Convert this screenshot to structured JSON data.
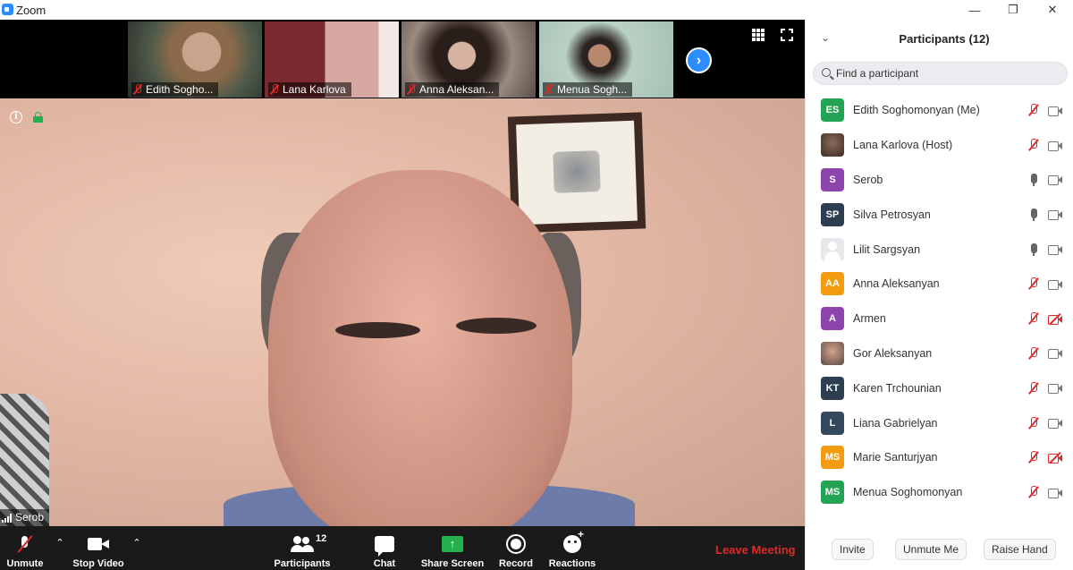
{
  "window": {
    "title": "Zoom",
    "controls": [
      "—",
      "❐",
      "✕"
    ]
  },
  "thumbnails": [
    {
      "name": "Edith Sogho...",
      "muted": true
    },
    {
      "name": "Lana Karlova",
      "muted": true
    },
    {
      "name": "Anna Aleksan...",
      "muted": true
    },
    {
      "name": "Menua Sogh...",
      "muted": true
    }
  ],
  "icons": {
    "next": "›",
    "info": "i",
    "caret": "⌃",
    "share_arrow": "↑",
    "collapse": "⌄"
  },
  "main_video": {
    "speaker": "Serob"
  },
  "toolbar": {
    "unmute": "Unmute",
    "stop_video": "Stop Video",
    "participants": "Participants",
    "participants_count": "12",
    "chat": "Chat",
    "share_screen": "Share Screen",
    "record": "Record",
    "reactions": "Reactions",
    "leave": "Leave Meeting"
  },
  "panel": {
    "title": "Participants (12)",
    "search_placeholder": "Find a participant",
    "participants": [
      {
        "initials": "ES",
        "name": "Edith Soghomonyan (Me)",
        "color": "#23a455",
        "mic": "off",
        "cam": "on"
      },
      {
        "initials": "",
        "name": "Lana Karlova (Host)",
        "color": "photo-lana",
        "mic": "off",
        "cam": "on"
      },
      {
        "initials": "S",
        "name": "Serob",
        "color": "#8e44ad",
        "mic": "on",
        "cam": "on"
      },
      {
        "initials": "SP",
        "name": "Silva Petrosyan",
        "color": "#2c3e50",
        "mic": "on",
        "cam": "on"
      },
      {
        "initials": "",
        "name": "Lilit Sargsyan",
        "color": "default",
        "mic": "on",
        "cam": "on"
      },
      {
        "initials": "AA",
        "name": "Anna Aleksanyan",
        "color": "#f39c12",
        "mic": "off",
        "cam": "on"
      },
      {
        "initials": "A",
        "name": "Armen",
        "color": "#8e44ad",
        "mic": "off",
        "cam": "off"
      },
      {
        "initials": "",
        "name": "Gor Aleksanyan",
        "color": "photo-gor",
        "mic": "off",
        "cam": "on"
      },
      {
        "initials": "KT",
        "name": "Karen Trchounian",
        "color": "#2c3e50",
        "mic": "off",
        "cam": "on"
      },
      {
        "initials": "L",
        "name": "Liana Gabrielyan",
        "color": "#34495e",
        "mic": "off",
        "cam": "on"
      },
      {
        "initials": "MS",
        "name": "Marie Santurjyan",
        "color": "#f39c12",
        "mic": "off",
        "cam": "off"
      },
      {
        "initials": "MS",
        "name": "Menua Soghomonyan",
        "color": "#23a455",
        "mic": "off",
        "cam": "on"
      }
    ],
    "footer": {
      "invite": "Invite",
      "unmute_me": "Unmute Me",
      "raise_hand": "Raise Hand"
    }
  }
}
